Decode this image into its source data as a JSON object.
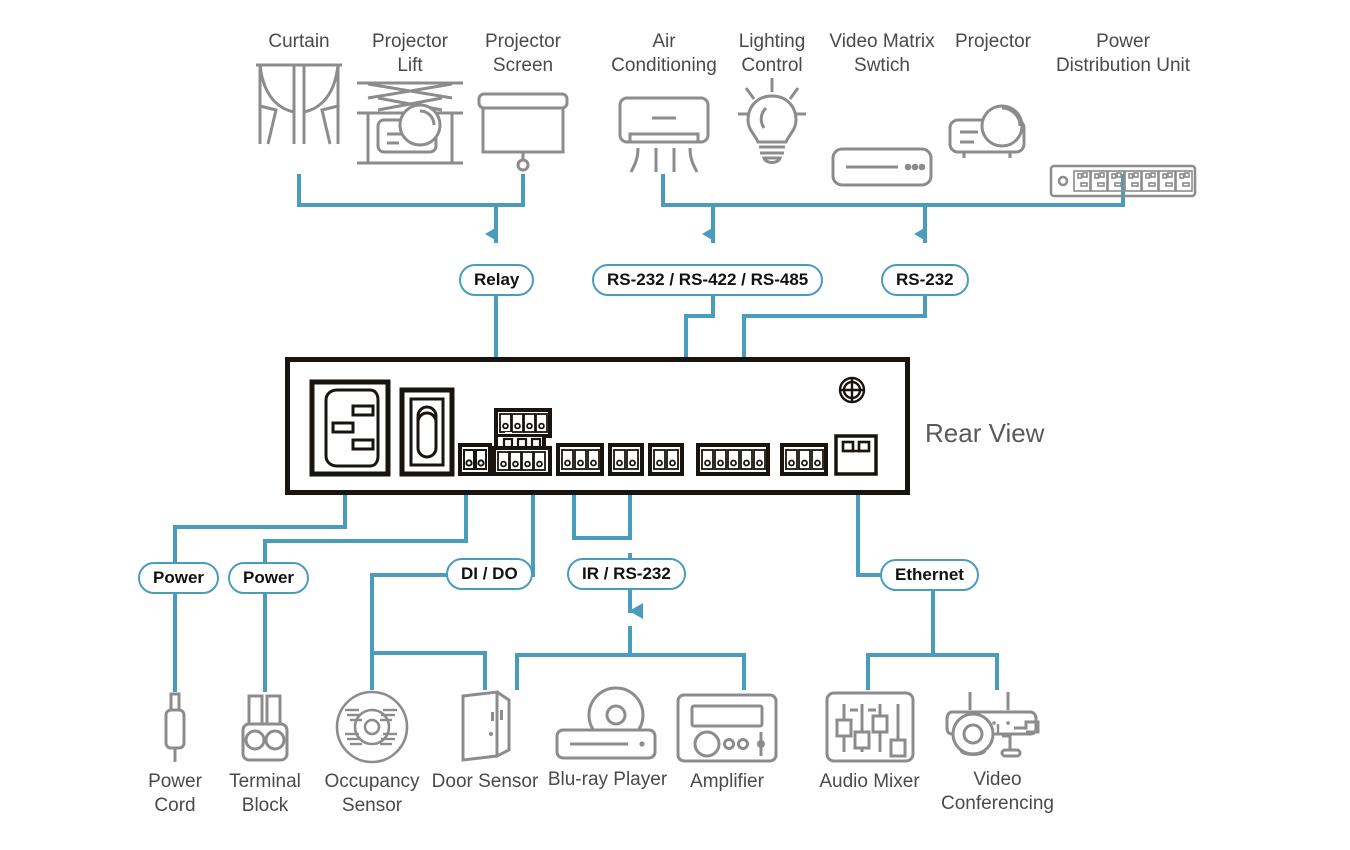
{
  "diagram": {
    "title": "Rear View",
    "accent_color": "#4a9cbd",
    "icon_color": "#8c8c8c",
    "text_color": "#4a4a4a",
    "panel_color": "#1a1411"
  },
  "top_devices": [
    {
      "label": "Curtain",
      "icon": "curtain-icon"
    },
    {
      "label": "Projector\nLift",
      "icon": "projector-lift-icon"
    },
    {
      "label": "Projector\nScreen",
      "icon": "projector-screen-icon"
    },
    {
      "label": "Air\nConditioning",
      "icon": "air-conditioning-icon"
    },
    {
      "label": "Lighting\nControl",
      "icon": "lighting-control-icon"
    },
    {
      "label": "Video Matrix\nSwtich",
      "icon": "video-matrix-switch-icon"
    },
    {
      "label": "Projector",
      "icon": "projector-icon"
    },
    {
      "label": "Power\nDistribution Unit",
      "icon": "power-distribution-unit-icon"
    }
  ],
  "top_connections": [
    {
      "label": "Relay",
      "name": "relay"
    },
    {
      "label": "RS-232 / RS-422 / RS-485",
      "name": "rs232-rs422-rs485"
    },
    {
      "label": "RS-232",
      "name": "rs232"
    }
  ],
  "bottom_connections": [
    {
      "label": "Power",
      "name": "power-left"
    },
    {
      "label": "Power",
      "name": "power-right"
    },
    {
      "label": "DI / DO",
      "name": "di-do"
    },
    {
      "label": "IR / RS-232",
      "name": "ir-rs232"
    },
    {
      "label": "Ethernet",
      "name": "ethernet"
    }
  ],
  "bottom_devices": [
    {
      "label": "Power\nCord",
      "icon": "power-cord-icon"
    },
    {
      "label": "Terminal\nBlock",
      "icon": "terminal-block-icon"
    },
    {
      "label": "Occupancy\nSensor",
      "icon": "occupancy-sensor-icon"
    },
    {
      "label": "Door Sensor",
      "icon": "door-sensor-icon"
    },
    {
      "label": "Blu-ray Player",
      "icon": "bluray-player-icon"
    },
    {
      "label": "Amplifier",
      "icon": "amplifier-icon"
    },
    {
      "label": "Audio Mixer",
      "icon": "audio-mixer-icon"
    },
    {
      "label": "Video\nConferencing",
      "icon": "video-conferencing-icon"
    }
  ],
  "panel_ports": [
    {
      "name": "ac-power-inlet",
      "type": "iec-inlet"
    },
    {
      "name": "power-switch",
      "type": "rocker-switch"
    },
    {
      "name": "terminal-2pin",
      "type": "terminal-2"
    },
    {
      "name": "relay-terminal-block",
      "type": "relay-stack"
    },
    {
      "name": "di-do-terminal-3pin-a",
      "type": "terminal-3"
    },
    {
      "name": "di-do-terminal-2pin",
      "type": "terminal-2"
    },
    {
      "name": "ir-terminal-2pin",
      "type": "terminal-2"
    },
    {
      "name": "serial-terminal-5pin",
      "type": "terminal-5"
    },
    {
      "name": "serial-terminal-3pin",
      "type": "terminal-3"
    },
    {
      "name": "grounding-screw",
      "type": "screw"
    },
    {
      "name": "ethernet-port",
      "type": "rj45"
    }
  ]
}
